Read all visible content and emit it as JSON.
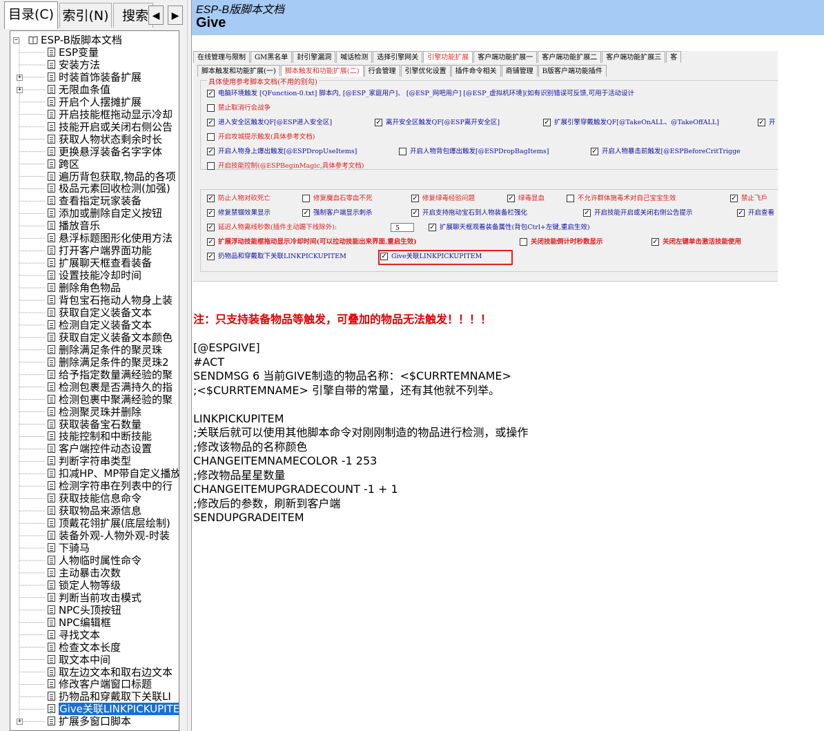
{
  "left_pane": {
    "tabs": {
      "contents": "目录(C)",
      "index": "索引(N)",
      "search": "搜索"
    },
    "arrows": {
      "prev": "◀",
      "next": "▶"
    },
    "tree_root": "ESP-B版脚本文档",
    "tree_items": [
      {
        "label": "ESP变量"
      },
      {
        "label": "安装方法"
      },
      {
        "label": "时装首饰装备扩展",
        "expander": "+"
      },
      {
        "label": "无限血条值",
        "expander": "+"
      },
      {
        "label": "开启个人摆摊扩展"
      },
      {
        "label": "开启技能框拖动显示冷却"
      },
      {
        "label": "技能开启或关闭右侧公告"
      },
      {
        "label": "获取人物状态剩余时长"
      },
      {
        "label": "更换悬浮装备名字字体"
      },
      {
        "label": "跨区"
      },
      {
        "label": "遍历背包获取,物品的各项"
      },
      {
        "label": "极品元素回收检测(加强)"
      },
      {
        "label": "查看指定玩家装备"
      },
      {
        "label": "添加或删除自定义按钮"
      },
      {
        "label": "播放音乐"
      },
      {
        "label": "悬浮标题图形化使用方法"
      },
      {
        "label": "打开客户端界面功能"
      },
      {
        "label": "扩展聊天框查看装备"
      },
      {
        "label": "设置技能冷却时间"
      },
      {
        "label": "删除角色物品"
      },
      {
        "label": "背包宝石拖动人物身上装"
      },
      {
        "label": "获取自定义装备文本"
      },
      {
        "label": "检测自定义装备文本"
      },
      {
        "label": "获取自定义装备文本颜色"
      },
      {
        "label": "删除满足条件的聚灵珠"
      },
      {
        "label": "删除满足条件的聚灵珠2"
      },
      {
        "label": "给予指定数量满经验的聚"
      },
      {
        "label": "检测包裹是否满持久的指"
      },
      {
        "label": "检测包裹中聚满经验的聚"
      },
      {
        "label": "检测聚灵珠并删除"
      },
      {
        "label": "获取装备宝石数量"
      },
      {
        "label": "技能控制和中断技能"
      },
      {
        "label": "客户端控件动态设置"
      },
      {
        "label": "判断字符串类型"
      },
      {
        "label": "扣减HP、MP带自定义播放"
      },
      {
        "label": "检测字符串在列表中的行"
      },
      {
        "label": "获取技能信息命令"
      },
      {
        "label": "获取物品来源信息"
      },
      {
        "label": "顶戴花翎扩展(底层绘制)"
      },
      {
        "label": "装备外观-人物外观-时装"
      },
      {
        "label": "下骑马"
      },
      {
        "label": "人物临时属性命令"
      },
      {
        "label": "主动暴击次数"
      },
      {
        "label": "锁定人物等级"
      },
      {
        "label": "判断当前攻击模式"
      },
      {
        "label": "NPC头顶按钮"
      },
      {
        "label": "NPC编辑框"
      },
      {
        "label": "寻找文本"
      },
      {
        "label": "检查文本长度"
      },
      {
        "label": "取文本中间"
      },
      {
        "label": "取左边文本和取右边文本"
      },
      {
        "label": "修改客户端窗口标题"
      },
      {
        "label": "扔物品和穿戴取下关联LI"
      },
      {
        "label": "Give关联LINKPICKUPITEM",
        "selected": true
      },
      {
        "label": "扩展多窗口脚本",
        "expander": "+"
      }
    ]
  },
  "header": {
    "subtitle": "ESP-B版脚本文档",
    "title": "Give"
  },
  "screenshot": {
    "tabs_row1": [
      "在线管理与限制",
      "GM黑名单",
      "封引擎漏洞",
      "喊话检测",
      "选择引擎网关",
      "引擎功能扩展",
      "客户端功能扩展一",
      "客户端功能扩展二",
      "客户端功能扩展三",
      "客"
    ],
    "tabs_row1_active": 5,
    "tabs_row2": [
      "脚本触发和功能扩展(一)",
      "脚本触发和功能扩展(二)",
      "行会管理",
      "引擎优化设置",
      "插件命令相关",
      "商铺管理",
      "B版客户端功能插件"
    ],
    "tabs_row2_active": 1,
    "group1_title": "具体使用参考脚本文档(不用的别勾)",
    "group1_rows": [
      [
        {
          "checked": true,
          "text": "电脑环境触发 [QFunction-0.txt] 脚本内, [@ESP_家庭用户]、 [@ESP_网吧用户] [@ESP_虚拟机环境](如有识别错误可反馈,可用于活动设计",
          "color": "blue"
        }
      ],
      [
        {
          "checked": false,
          "text": "禁止取消行会战争",
          "color": "red"
        }
      ],
      [
        {
          "checked": true,
          "text": "进入安全区触发QF[@ESP进入安全区]",
          "color": "blue"
        },
        {
          "checked": true,
          "text": "离开安全区触发QF[@ESP离开安全区]",
          "color": "blue"
        },
        {
          "checked": true,
          "text": "扩展引擎穿戴触发QF[@TakeOnALL、@TakeOffALL]",
          "color": "blue"
        },
        {
          "checked": true,
          "text": "开",
          "color": "blue"
        }
      ],
      [
        {
          "checked": false,
          "text": "开启攻城提示触发(具体参考文档)",
          "color": "red"
        }
      ],
      [
        {
          "checked": true,
          "text": "开启人物身上爆出触发[@ESPDropUseItems]",
          "color": "blue"
        },
        {
          "checked": false,
          "text": "开启人物背包爆出触发[@ESPDropBagItems]",
          "color": "blue"
        },
        {
          "checked": true,
          "text": "开启人物暴击前触发[@ESPBeforeCritTrigge",
          "color": "blue"
        }
      ],
      [
        {
          "checked": false,
          "text": "开启技能控制(@ESPBeginMagic,具体参考文档)",
          "color": "red"
        }
      ]
    ],
    "group2_rows": [
      [
        {
          "checked": true,
          "text": "防止人物对砍死亡",
          "color": "red"
        },
        {
          "checked": false,
          "text": "修复魔血石零血不死",
          "color": "red"
        },
        {
          "checked": true,
          "text": "修复绿毒经验问题",
          "color": "red"
        },
        {
          "checked": true,
          "text": "绿毒显血",
          "color": "red"
        },
        {
          "checked": false,
          "text": "不允许群体施毒术对自己宝宝生效",
          "color": "red"
        },
        {
          "checked": true,
          "text": "禁止飞戶",
          "color": "red"
        }
      ],
      [
        {
          "checked": true,
          "text": "修复禁锢效果显示",
          "color": "blue"
        },
        {
          "checked": true,
          "text": "强制客户端显示刺杀",
          "color": "blue"
        },
        {
          "checked": true,
          "text": "开启支持拖动宝石到人物装备栏强化",
          "color": "blue"
        },
        {
          "checked": true,
          "text": "开启技能开启或关闭右侧公告提示",
          "color": "blue"
        },
        {
          "checked": true,
          "text": "开启查看",
          "color": "blue"
        }
      ],
      [
        {
          "checked": true,
          "text": "延迟人物离线秒数(插件主动踢下线除外):",
          "color": "red",
          "number": "5"
        },
        {
          "checked": true,
          "text": "扩展聊天框观看装备属性(背包Ctrl+左键,重启生效)",
          "color": "blue"
        }
      ],
      [
        {
          "checked": true,
          "text": "扩展浮动技能框拖动显示冷却时间(可以拉动技能出来界面,重启生效)",
          "color": "red",
          "bold": true
        },
        {
          "checked": false,
          "text": "关闭技能倒计时秒数显示",
          "color": "red",
          "bold": true
        },
        {
          "checked": true,
          "text": "关闭左键单击激活技能使用",
          "color": "red",
          "bold": true
        }
      ],
      [
        {
          "checked": true,
          "text": "扔物品和穿戴取下关联LINKPICKUPITEM",
          "color": "blue"
        },
        {
          "checked": true,
          "text": "Give关联LINKPICKUPITEM",
          "color": "blue"
        }
      ]
    ]
  },
  "note": "注：只支持装备物品等触发，可叠加的物品无法触发！！！！",
  "code_lines": [
    "[@ESPGIVE]",
    "#ACT",
    "SENDMSG 6 当前GIVE制造的物品名称：<$CURRTEMNAME>",
    ";<$CURRTEMNAME> 引擎自带的常量，还有其他就不列举。",
    "",
    "LINKPICKUPITEM",
    ";关联后就可以使用其他脚本命令对刚刚制造的物品进行检测，或操作",
    ";修改该物品的名称颜色",
    "CHANGEITEMNAMECOLOR -1 253",
    ";修改物品星星数量",
    "CHANGEITEMUPGRADECOUNT -1 + 1",
    ";修改后的参数，刷新到客户端",
    "SENDUPGRADEITEM"
  ]
}
